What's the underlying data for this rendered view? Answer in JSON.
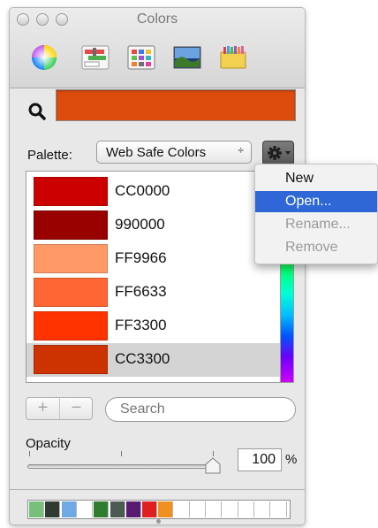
{
  "window": {
    "title": "Colors",
    "toolbar_icons": [
      "color-wheel-icon",
      "color-sliders-icon",
      "color-palettes-icon",
      "image-palettes-icon",
      "crayons-icon"
    ]
  },
  "current_color": {
    "hex": "#dd4c0d"
  },
  "palette": {
    "label": "Palette:",
    "selected": "Web Safe Colors",
    "arrow": "÷"
  },
  "colors": [
    {
      "name": "CC0000",
      "hex": "#cc0000"
    },
    {
      "name": "990000",
      "hex": "#990000"
    },
    {
      "name": "FF9966",
      "hex": "#ff9966"
    },
    {
      "name": "FF6633",
      "hex": "#ff6633"
    },
    {
      "name": "FF3300",
      "hex": "#ff3300"
    },
    {
      "name": "CC3300",
      "hex": "#cc3300"
    }
  ],
  "selected_index": 5,
  "controls": {
    "plus": "+",
    "minus": "−",
    "search_placeholder": "Search"
  },
  "opacity": {
    "label": "Opacity",
    "value": "100",
    "unit": "%",
    "level": 1.0
  },
  "swatch_tray": [
    "#76c07a",
    "#2f3a32",
    "#6fa9e6",
    "#ffffff",
    "#2f7d2f",
    "#4d5a52",
    "#5a1a72",
    "#e02020",
    "#f09020",
    "#ffffff",
    "#ffffff",
    "#ffffff",
    "#ffffff",
    "#ffffff",
    "#ffffff",
    "#ffffff"
  ],
  "menu": {
    "items": [
      {
        "label": "New",
        "state": "enabled"
      },
      {
        "label": "Open...",
        "state": "highlighted"
      },
      {
        "label": "Rename...",
        "state": "disabled"
      },
      {
        "label": "Remove",
        "state": "disabled"
      }
    ]
  }
}
